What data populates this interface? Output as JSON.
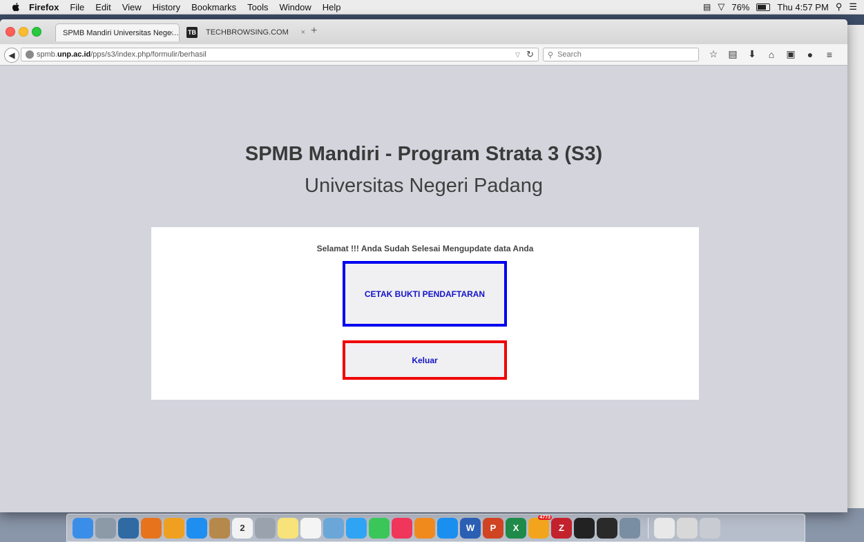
{
  "menubar": {
    "app_name": "Firefox",
    "items": [
      "File",
      "Edit",
      "View",
      "History",
      "Bookmarks",
      "Tools",
      "Window",
      "Help"
    ],
    "battery": "76%",
    "clock": "Thu 4:57 PM"
  },
  "tabs": [
    {
      "label": "SPMB Mandiri Universitas Nege…",
      "close": "×"
    },
    {
      "label": "TECHBROWSING.COM",
      "close": "×",
      "favicon": "TB"
    }
  ],
  "newtab_label": "+",
  "urlbar": {
    "prefix": "spmb.",
    "domain": "unp.ac.id",
    "path": "/pps/s3/index.php/formulir/berhasil"
  },
  "search": {
    "placeholder": "Search"
  },
  "toolbar_icons": [
    "bookmark-star-icon",
    "reading-list-icon",
    "download-icon",
    "home-icon",
    "youtube-icon",
    "chat-icon",
    "menu-icon"
  ],
  "page": {
    "title": "SPMB Mandiri - Program Strata 3 (S3)",
    "subtitle": "Universitas Negeri Padang",
    "message": "Selamat !!! Anda Sudah Selesai Mengupdate data Anda",
    "print_button": "CETAK BUKTI PENDAFTARAN",
    "exit_button": "Keluar"
  },
  "colors": {
    "page_bg": "#d3d4dc",
    "print_border": "#0000f0",
    "exit_border": "#f00000",
    "button_text": "#1313c8"
  },
  "dock_icons": [
    {
      "name": "finder-icon",
      "color": "#3b8ee8"
    },
    {
      "name": "launchpad-icon",
      "color": "#8c9aa8"
    },
    {
      "name": "mysql-workbench-icon",
      "color": "#2f6aa3"
    },
    {
      "name": "firefox-icon",
      "color": "#e8731d"
    },
    {
      "name": "uc-browser-icon",
      "color": "#f0a020"
    },
    {
      "name": "safari-icon",
      "color": "#1e8ef0"
    },
    {
      "name": "contacts-icon",
      "color": "#b5894c"
    },
    {
      "name": "calendar-icon",
      "color": "#f2f2f2",
      "text": "2"
    },
    {
      "name": "system-preferences-icon",
      "color": "#9aa3ad"
    },
    {
      "name": "notes-icon",
      "color": "#f7e37a"
    },
    {
      "name": "reminders-icon",
      "color": "#f4f4f4"
    },
    {
      "name": "preview-icon",
      "color": "#6aa7d8"
    },
    {
      "name": "messages-icon",
      "color": "#2fa4f4"
    },
    {
      "name": "facetime-icon",
      "color": "#3ac659"
    },
    {
      "name": "itunes-icon",
      "color": "#f0365a"
    },
    {
      "name": "ibooks-icon",
      "color": "#f08a1c"
    },
    {
      "name": "app-store-icon",
      "color": "#1a8ff0"
    },
    {
      "name": "word-icon",
      "color": "#2b5fb4",
      "text": "W"
    },
    {
      "name": "powerpoint-icon",
      "color": "#d04423",
      "text": "P"
    },
    {
      "name": "excel-icon",
      "color": "#1f8a4a",
      "text": "X"
    },
    {
      "name": "ucbrowser2-icon",
      "color": "#f2a51c",
      "badge": "4773"
    },
    {
      "name": "filezilla-icon",
      "color": "#c3222d",
      "text": "Z"
    },
    {
      "name": "terminal-icon",
      "color": "#222222"
    },
    {
      "name": "activity-monitor-icon",
      "color": "#2a2a2a"
    },
    {
      "name": "image-capture-icon",
      "color": "#7a8ea3"
    },
    {
      "name": "documents-icon",
      "color": "#e8e8e8"
    },
    {
      "name": "downloads-icon",
      "color": "#d8d8d8"
    },
    {
      "name": "trash-icon",
      "color": "#c8ccd2"
    }
  ]
}
